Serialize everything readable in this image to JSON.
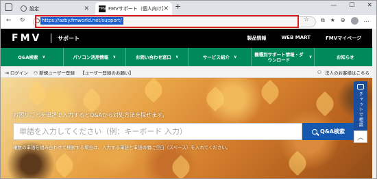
{
  "browser": {
    "tabs": [
      {
        "label": "設定",
        "icon": "gear-icon"
      },
      {
        "label": "FMVサポート（個人向け富士通パソコン）",
        "icon": "fmv-favicon"
      }
    ],
    "new_tab": "+",
    "window_controls": {
      "minimize": "—",
      "maximize": "☐",
      "close": "✕"
    },
    "address": {
      "url": "https://azby.fmworld.net/support/"
    },
    "nav": {
      "back": "←",
      "refresh": "↻"
    },
    "toolbar_glyphs": {
      "favorite": "☆",
      "split": "⧉",
      "favorites": "★",
      "collections": "⊕",
      "more": "…"
    }
  },
  "site": {
    "logo": "FMV",
    "logo_sub": "サポート",
    "header_links": [
      "製品情報",
      "WEB MART",
      "FMVマイページ"
    ],
    "nav_items": [
      {
        "label": "Q&A検索",
        "chevron": "∨"
      },
      {
        "label": "パソコン活用情報",
        "chevron": "∨"
      },
      {
        "label": "お問い合わせ窓口",
        "chevron": "∨"
      },
      {
        "label": "サービス紹介",
        "chevron": "∨"
      },
      {
        "label": "機種別サポート情報・ダウンロード",
        "chevron": "∨"
      },
      {
        "label": "お知らせ",
        "chevron": ""
      }
    ],
    "sub_bar": {
      "login": "ログイン",
      "new_user": "新規ユーザー登録",
      "user_reg_notice": "【ユーザー登録のお願い】",
      "corporate": "法人のお客様はこちら"
    },
    "hero": {
      "lead": "お困りごとを単語で入力するとQ&Aから対処方法を探せます。",
      "search_placeholder": "単語を入力してください（例：キーボード 入力）",
      "search_button": "Q&A検索",
      "note": "複数の単語を組み合わせて検索する場合は、入力する単語と単語の間に空白（スペース）を入れてください。"
    },
    "chat_tab": "チャットで相談",
    "scroll_top": "︿"
  },
  "colors": {
    "header_bg": "#000000",
    "nav_green": "#008a5c",
    "search_button": "#1558b0",
    "chat_tab": "#1a4e9c",
    "url_highlight_border": "#e01d1d"
  }
}
